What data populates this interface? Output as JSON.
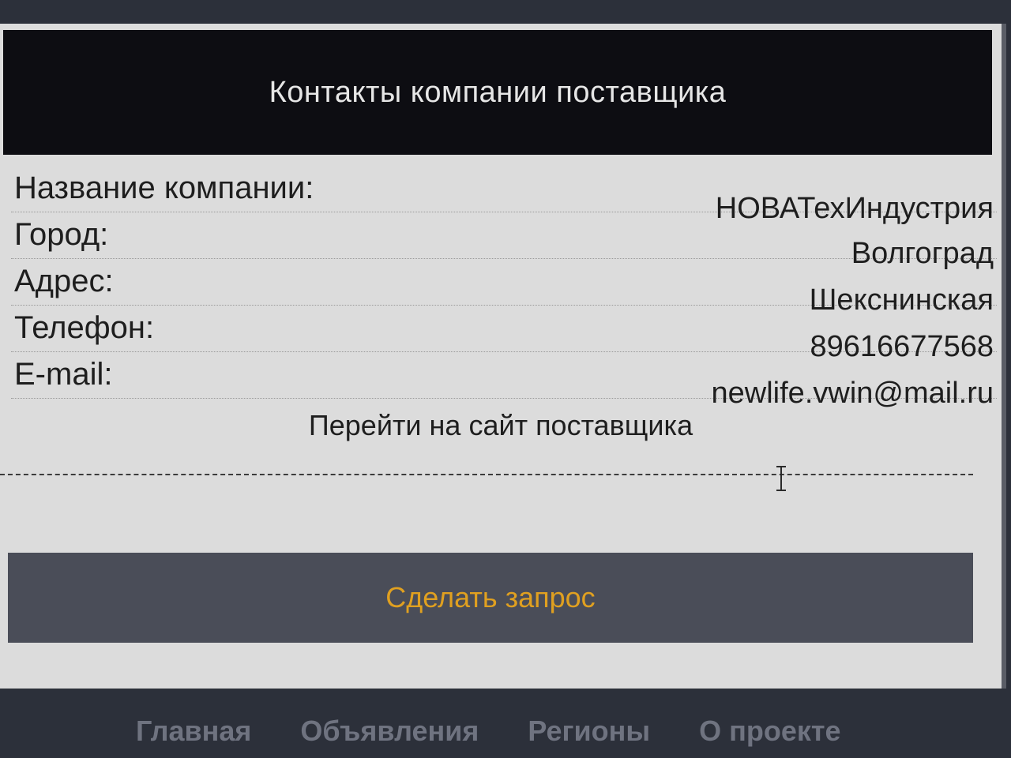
{
  "header": {
    "title": "Контакты компании поставщика"
  },
  "company": {
    "rows": [
      {
        "label": "Название компании:",
        "value": "НОВАТехИндустрия"
      },
      {
        "label": "Город:",
        "value": "Волгоград"
      },
      {
        "label": "Адрес:",
        "value": "Шекснинская"
      },
      {
        "label": "Телефон:",
        "value": "89616677568"
      },
      {
        "label": "E-mail:",
        "value": "newlife.vwin@mail.ru"
      }
    ],
    "site_link": "Перейти на сайт поставщика"
  },
  "actions": {
    "request_label": "Сделать запрос"
  },
  "footer": {
    "nav": [
      "Главная",
      "Объявления",
      "Регионы",
      "О проекте"
    ]
  },
  "colors": {
    "header_bg": "#0d0d12",
    "card_bg": "#dcdcdc",
    "button_bg": "#4a4d58",
    "button_text": "#e0a020",
    "footer_text": "#6f7380"
  },
  "icons": {
    "cursor": "text-cursor-icon"
  }
}
